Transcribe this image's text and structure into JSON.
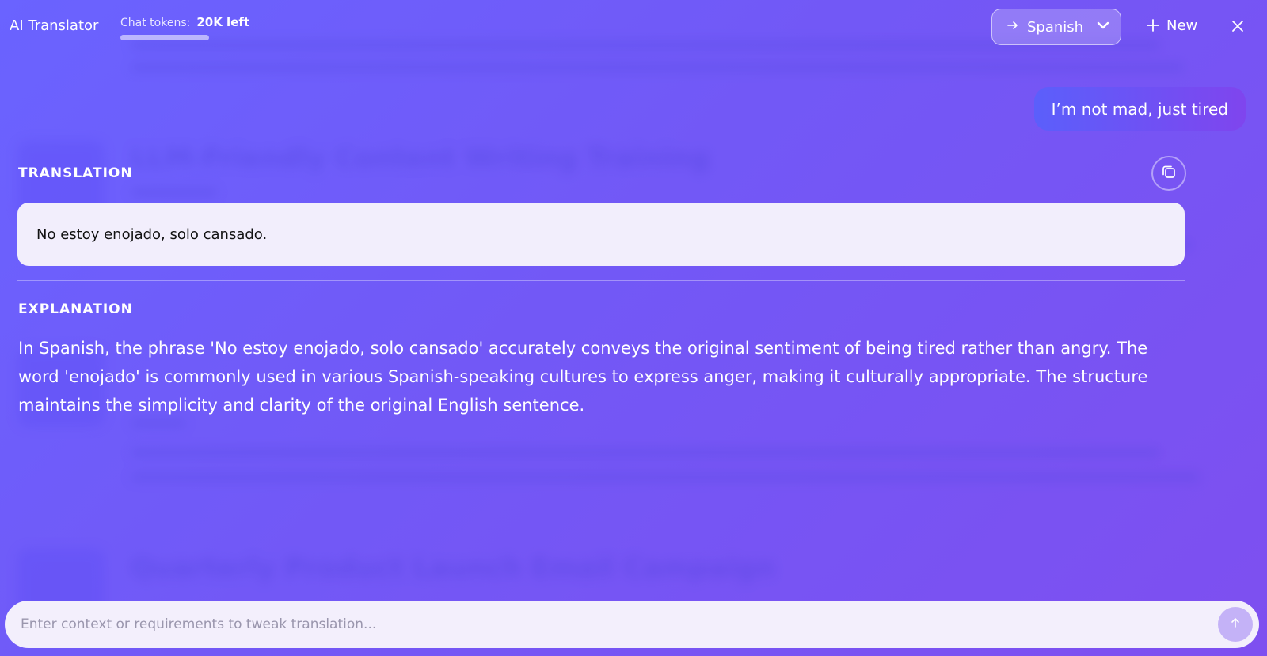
{
  "header": {
    "app_title": "AI Translator",
    "tokens_label": "Chat tokens:",
    "tokens_value": "20K left",
    "target_language": "Spanish",
    "new_label": "New"
  },
  "conversation": {
    "user_message": "I’m not mad, just tired",
    "translation_heading": "TRANSLATION",
    "translation_text": "No estoy enojado, solo cansado.",
    "explanation_heading": "EXPLANATION",
    "explanation_text": "In Spanish, the phrase 'No estoy enojado, solo cansado' accurately conveys the original sentiment of being tired rather than angry. The word 'enojado' is commonly used in various Spanish-speaking cultures to express anger, making it culturally appropriate. The structure maintains the simplicity and clarity of the original English sentence."
  },
  "input": {
    "placeholder": "Enter context or requirements to tweak translation..."
  },
  "background": {
    "titles": [
      "LLM-Friendly Content Writing Training",
      "Quarterly Product Launch Email Campaign"
    ]
  },
  "icons": {
    "language_arrow": "arrow-right-icon",
    "dropdown": "chevron-down-icon",
    "new": "plus-icon",
    "close": "close-icon",
    "copy": "copy-icon",
    "send": "arrow-up-icon"
  },
  "colors": {
    "background_start": "#6a63ff",
    "background_end": "#7e4ff0",
    "card_bg": "#f2eefc",
    "send_button": "#c4b2f7"
  }
}
